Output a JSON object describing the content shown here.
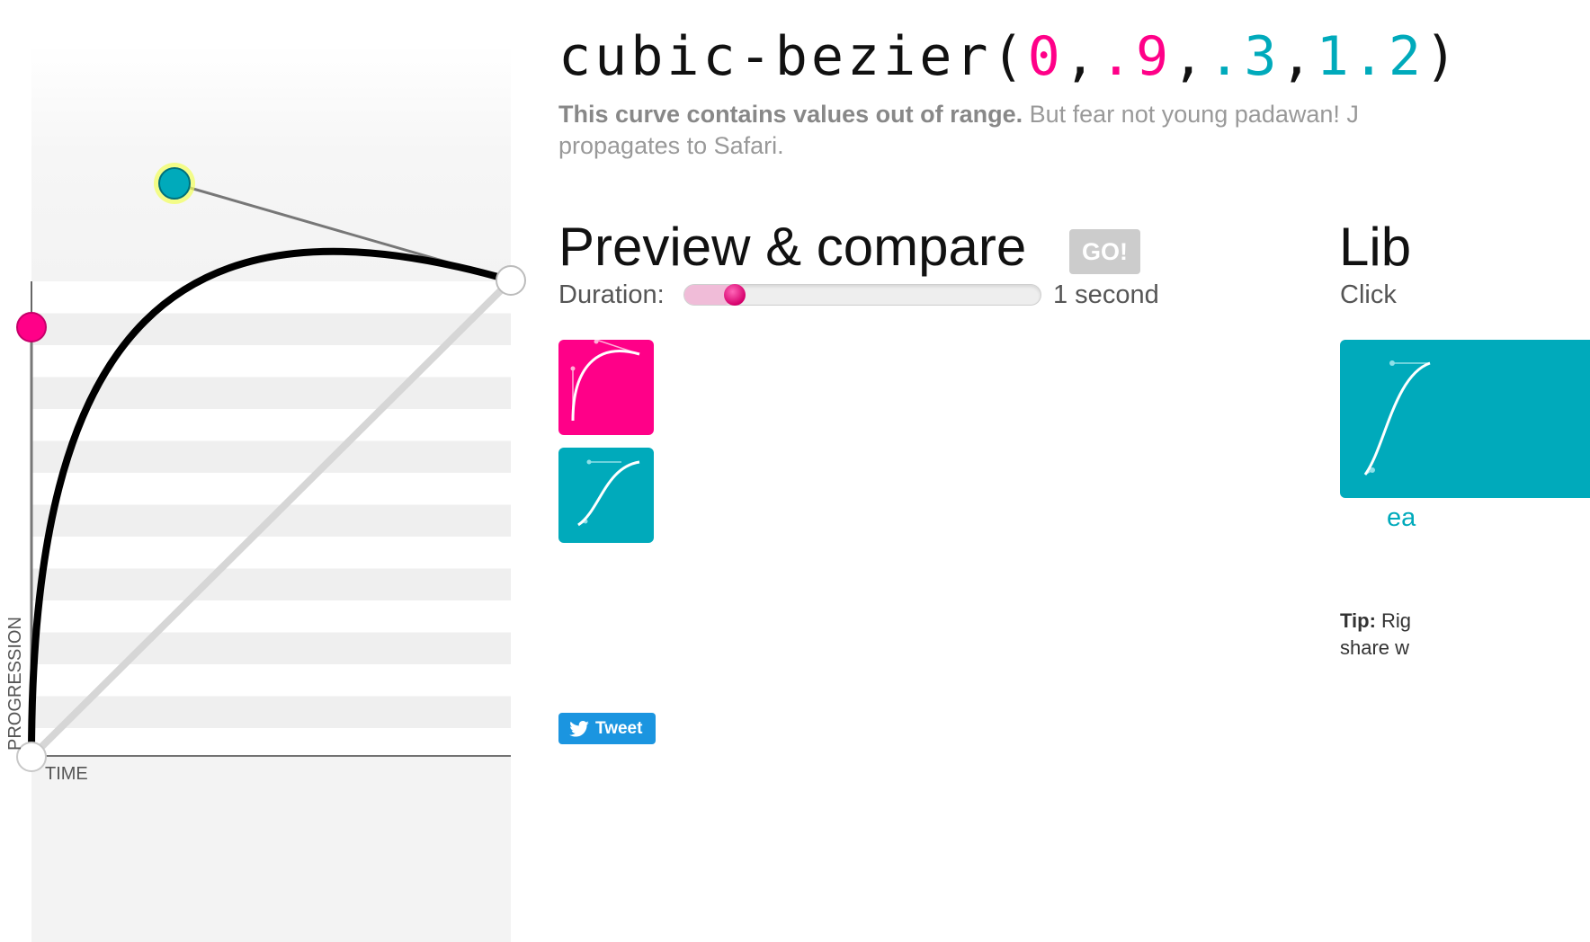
{
  "title": {
    "prefix": "cubic-bezier(",
    "p1x": "0",
    "sep1": ",",
    "p1y": ".9",
    "sep2": ",",
    "p2x": ".3",
    "sep3": ",",
    "p2y": "1.2",
    "suffix": ")"
  },
  "warning": {
    "bold": "This curve contains values out of range.",
    "text": " But fear not young padawan! J",
    "line2": "propagates to Safari."
  },
  "graph": {
    "time_label": "TIME",
    "progression_label": "PROGRESSION",
    "control_points": {
      "p1": [
        0,
        0.9
      ],
      "p2": [
        0.3,
        1.2
      ]
    }
  },
  "preview": {
    "heading": "Preview & compare",
    "go_label": "GO!",
    "duration_label": "Duration:",
    "duration_value": "1 second",
    "duration_fraction": 0.11
  },
  "library": {
    "heading": "Lib",
    "hint": "Click",
    "item_label": "ea",
    "tip_bold": "Tip:",
    "tip_text": " Rig",
    "tip_line2": "share w"
  },
  "tweet": {
    "label": "Tweet"
  },
  "colors": {
    "pink": "#ff0088",
    "teal": "#00aabb",
    "twitter": "#1b95e0"
  },
  "icons": {
    "twitter": "twitter-bird-icon"
  }
}
